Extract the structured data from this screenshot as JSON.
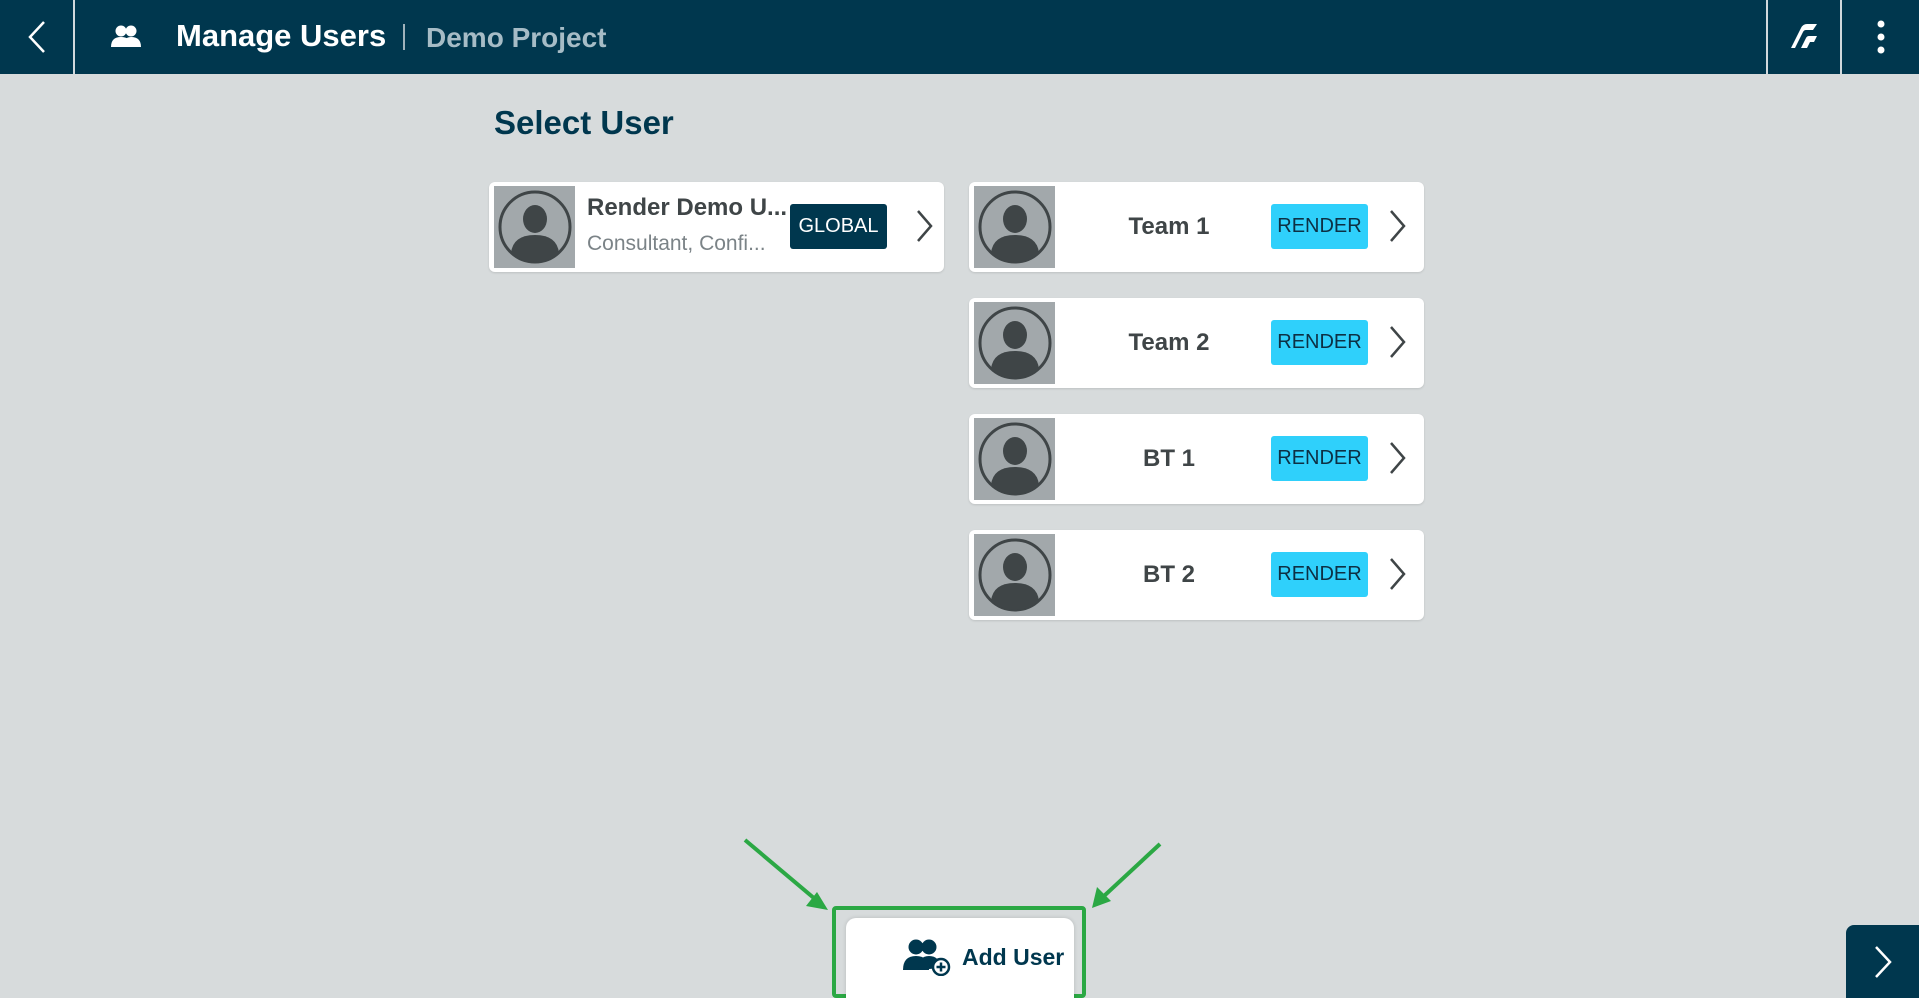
{
  "header": {
    "title": "Manage Users",
    "project": "Demo Project",
    "icons": [
      "back-chevron-icon",
      "users-icon",
      "brand-logo-icon",
      "more-vert-icon"
    ]
  },
  "main": {
    "section_title": "Select User",
    "global_user": {
      "name": "Render Demo U...",
      "subtitle": "Consultant, Confi...",
      "badge": "GLOBAL"
    },
    "teams": [
      {
        "name": "Team 1",
        "badge": "RENDER"
      },
      {
        "name": "Team 2",
        "badge": "RENDER"
      },
      {
        "name": "BT 1",
        "badge": "RENDER"
      },
      {
        "name": "BT 2",
        "badge": "RENDER"
      }
    ]
  },
  "footer": {
    "add_user_label": "Add User"
  },
  "colors": {
    "header_bg": "#00374e",
    "page_bg": "#d7dbdc",
    "global_badge": "#00374e",
    "render_badge": "#2fd0fb",
    "highlight": "#2ba844"
  }
}
